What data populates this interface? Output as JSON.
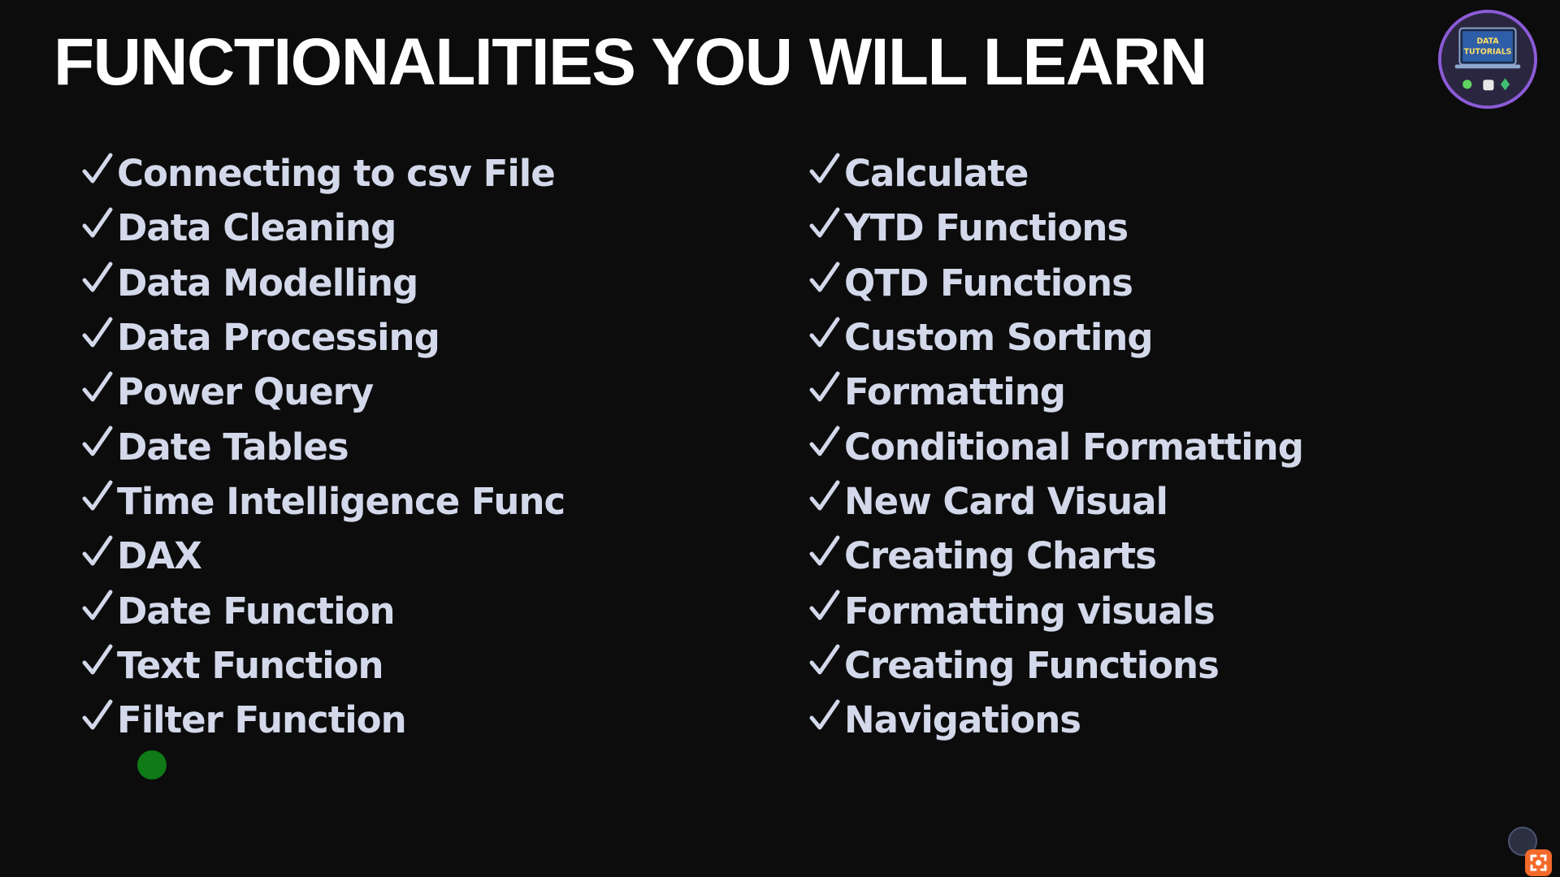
{
  "slide": {
    "title": "FUNCTIONALITIES YOU WILL LEARN",
    "logo_icon": "data-tutorials-logo",
    "logo_lines": [
      "DATA",
      "TUTORIALS"
    ],
    "check_icon": "checkmark-icon",
    "left_items": [
      "Connecting to csv File",
      "Data Cleaning",
      "Data Modelling",
      "Data Processing",
      "Power Query",
      "Date Tables",
      "Time Intelligence Func",
      "DAX",
      "Date Function",
      "Text Function",
      "Filter Function"
    ],
    "right_items": [
      "Calculate",
      "YTD Functions",
      "QTD Functions",
      "Custom Sorting",
      "Formatting",
      "Conditional Formatting",
      "New Card Visual",
      "Creating Charts",
      "Formatting visuals",
      "Creating Functions",
      "Navigations"
    ]
  },
  "colors": {
    "background": "#0c0c0c",
    "title": "#ffffff",
    "item_text": "#d3d9ea",
    "checkmark": "#d3d9ea",
    "pointer_dot": "#0f7a16",
    "logo_ring": "#8c5bd6",
    "corner_badge": "#f46a2a"
  },
  "overlay": {
    "pointer_icon": "laser-pointer-dot",
    "corner_avatar_icon": "channel-avatar-icon",
    "corner_badge_icon": "screen-capture-icon"
  }
}
